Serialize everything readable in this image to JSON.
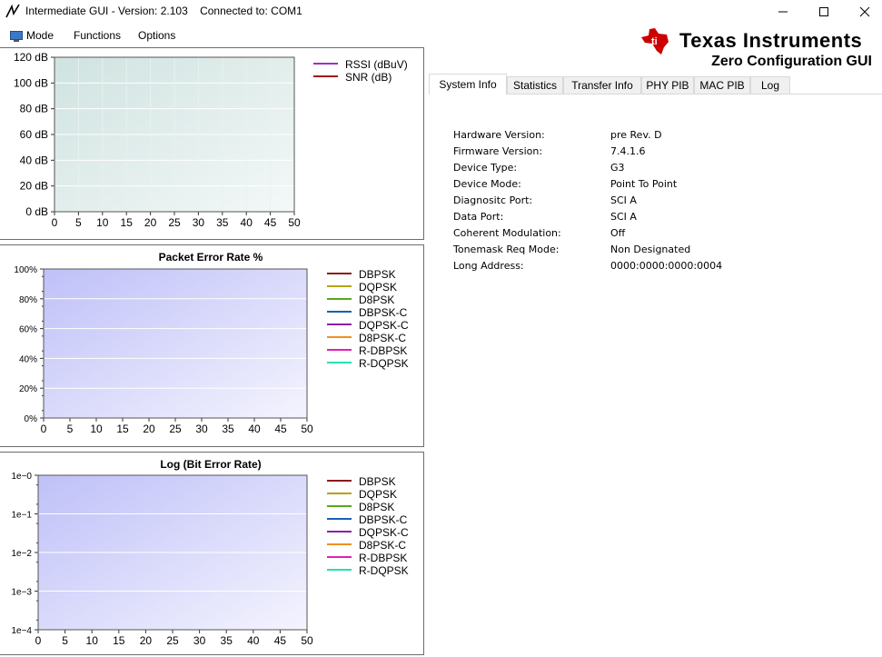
{
  "window": {
    "title": "Intermediate GUI - Version: 2.103    Connected to: COM1",
    "minimize_icon": "minimize-icon",
    "maximize_icon": "maximize-icon",
    "close_icon": "close-icon"
  },
  "menu": {
    "items": [
      "Mode",
      "Functions",
      "Options"
    ]
  },
  "branding": {
    "company": "Texas Instruments",
    "product": "Zero Configuration GUI"
  },
  "tabs": [
    "System Info",
    "Statistics",
    "Transfer Info",
    "PHY PIB",
    "MAC PIB",
    "Log"
  ],
  "active_tab": "System Info",
  "system_info": [
    {
      "label": "Hardware Version:",
      "value": "pre Rev. D"
    },
    {
      "label": "Firmware Version:",
      "value": "7.4.1.6"
    },
    {
      "label": "Device Type:",
      "value": "G3"
    },
    {
      "label": "Device Mode:",
      "value": "Point To Point"
    },
    {
      "label": "Diagnositc Port:",
      "value": "SCI A"
    },
    {
      "label": "Data Port:",
      "value": "SCI A"
    },
    {
      "label": "Coherent Modulation:",
      "value": "Off"
    },
    {
      "label": "Tonemask Req Mode:",
      "value": "Non Designated"
    },
    {
      "label": "Long Address:",
      "value": "0000:0000:0000:0004"
    }
  ],
  "chart_data": [
    {
      "type": "line",
      "title": "",
      "x_ticks": [
        "0",
        "5",
        "10",
        "15",
        "20",
        "25",
        "30",
        "35",
        "40",
        "45",
        "50"
      ],
      "y_ticks": [
        "0 dB",
        "20 dB",
        "40 dB",
        "60 dB",
        "80 dB",
        "100 dB",
        "120 dB"
      ],
      "xlim": [
        0,
        50
      ],
      "ylim": [
        0,
        120
      ],
      "grid": true,
      "legend_position": "top-right",
      "series": [
        {
          "name": "RSSI (dBuV)",
          "color": "#9b30c8",
          "values": []
        },
        {
          "name": "SNR (dB)",
          "color": "#a01818",
          "values": []
        }
      ]
    },
    {
      "type": "line",
      "title": "Packet Error Rate %",
      "x_ticks": [
        "0",
        "5",
        "10",
        "15",
        "20",
        "25",
        "30",
        "35",
        "40",
        "45",
        "50"
      ],
      "y_ticks": [
        "0%",
        "20%",
        "40%",
        "60%",
        "80%",
        "100%"
      ],
      "xlim": [
        0,
        50
      ],
      "ylim": [
        0,
        100
      ],
      "grid": true,
      "legend_position": "right",
      "series": [
        {
          "name": "DBPSK",
          "color": "#8b1a1a",
          "values": []
        },
        {
          "name": "DQPSK",
          "color": "#b5a21a",
          "values": []
        },
        {
          "name": "D8PSK",
          "color": "#5aa51e",
          "values": []
        },
        {
          "name": "DBPSK-C",
          "color": "#1c5fb4",
          "values": []
        },
        {
          "name": "DQPSK-C",
          "color": "#8c1fa8",
          "values": []
        },
        {
          "name": "D8PSK-C",
          "color": "#f0901e",
          "values": []
        },
        {
          "name": "R-DBPSK",
          "color": "#e020b4",
          "values": []
        },
        {
          "name": "R-DQPSK",
          "color": "#28e0b4",
          "values": []
        }
      ]
    },
    {
      "type": "line",
      "title": "Log (Bit Error Rate)",
      "x_ticks": [
        "0",
        "5",
        "10",
        "15",
        "20",
        "25",
        "30",
        "35",
        "40",
        "45",
        "50"
      ],
      "y_ticks": [
        "1e−4",
        "1e−3",
        "1e−2",
        "1e−1",
        "1e−0"
      ],
      "xlim": [
        0,
        50
      ],
      "ylim": [
        -4,
        0
      ],
      "log_scale_y": true,
      "grid": true,
      "legend_position": "right",
      "series": [
        {
          "name": "DBPSK",
          "color": "#8b1a1a",
          "values": []
        },
        {
          "name": "DQPSK",
          "color": "#b5a21a",
          "values": []
        },
        {
          "name": "D8PSK",
          "color": "#5aa51e",
          "values": []
        },
        {
          "name": "DBPSK-C",
          "color": "#1c5fb4",
          "values": []
        },
        {
          "name": "DQPSK-C",
          "color": "#8c1fa8",
          "values": []
        },
        {
          "name": "D8PSK-C",
          "color": "#f0901e",
          "values": []
        },
        {
          "name": "R-DBPSK",
          "color": "#e020b4",
          "values": []
        },
        {
          "name": "R-DQPSK",
          "color": "#28e0b4",
          "values": []
        }
      ]
    }
  ]
}
